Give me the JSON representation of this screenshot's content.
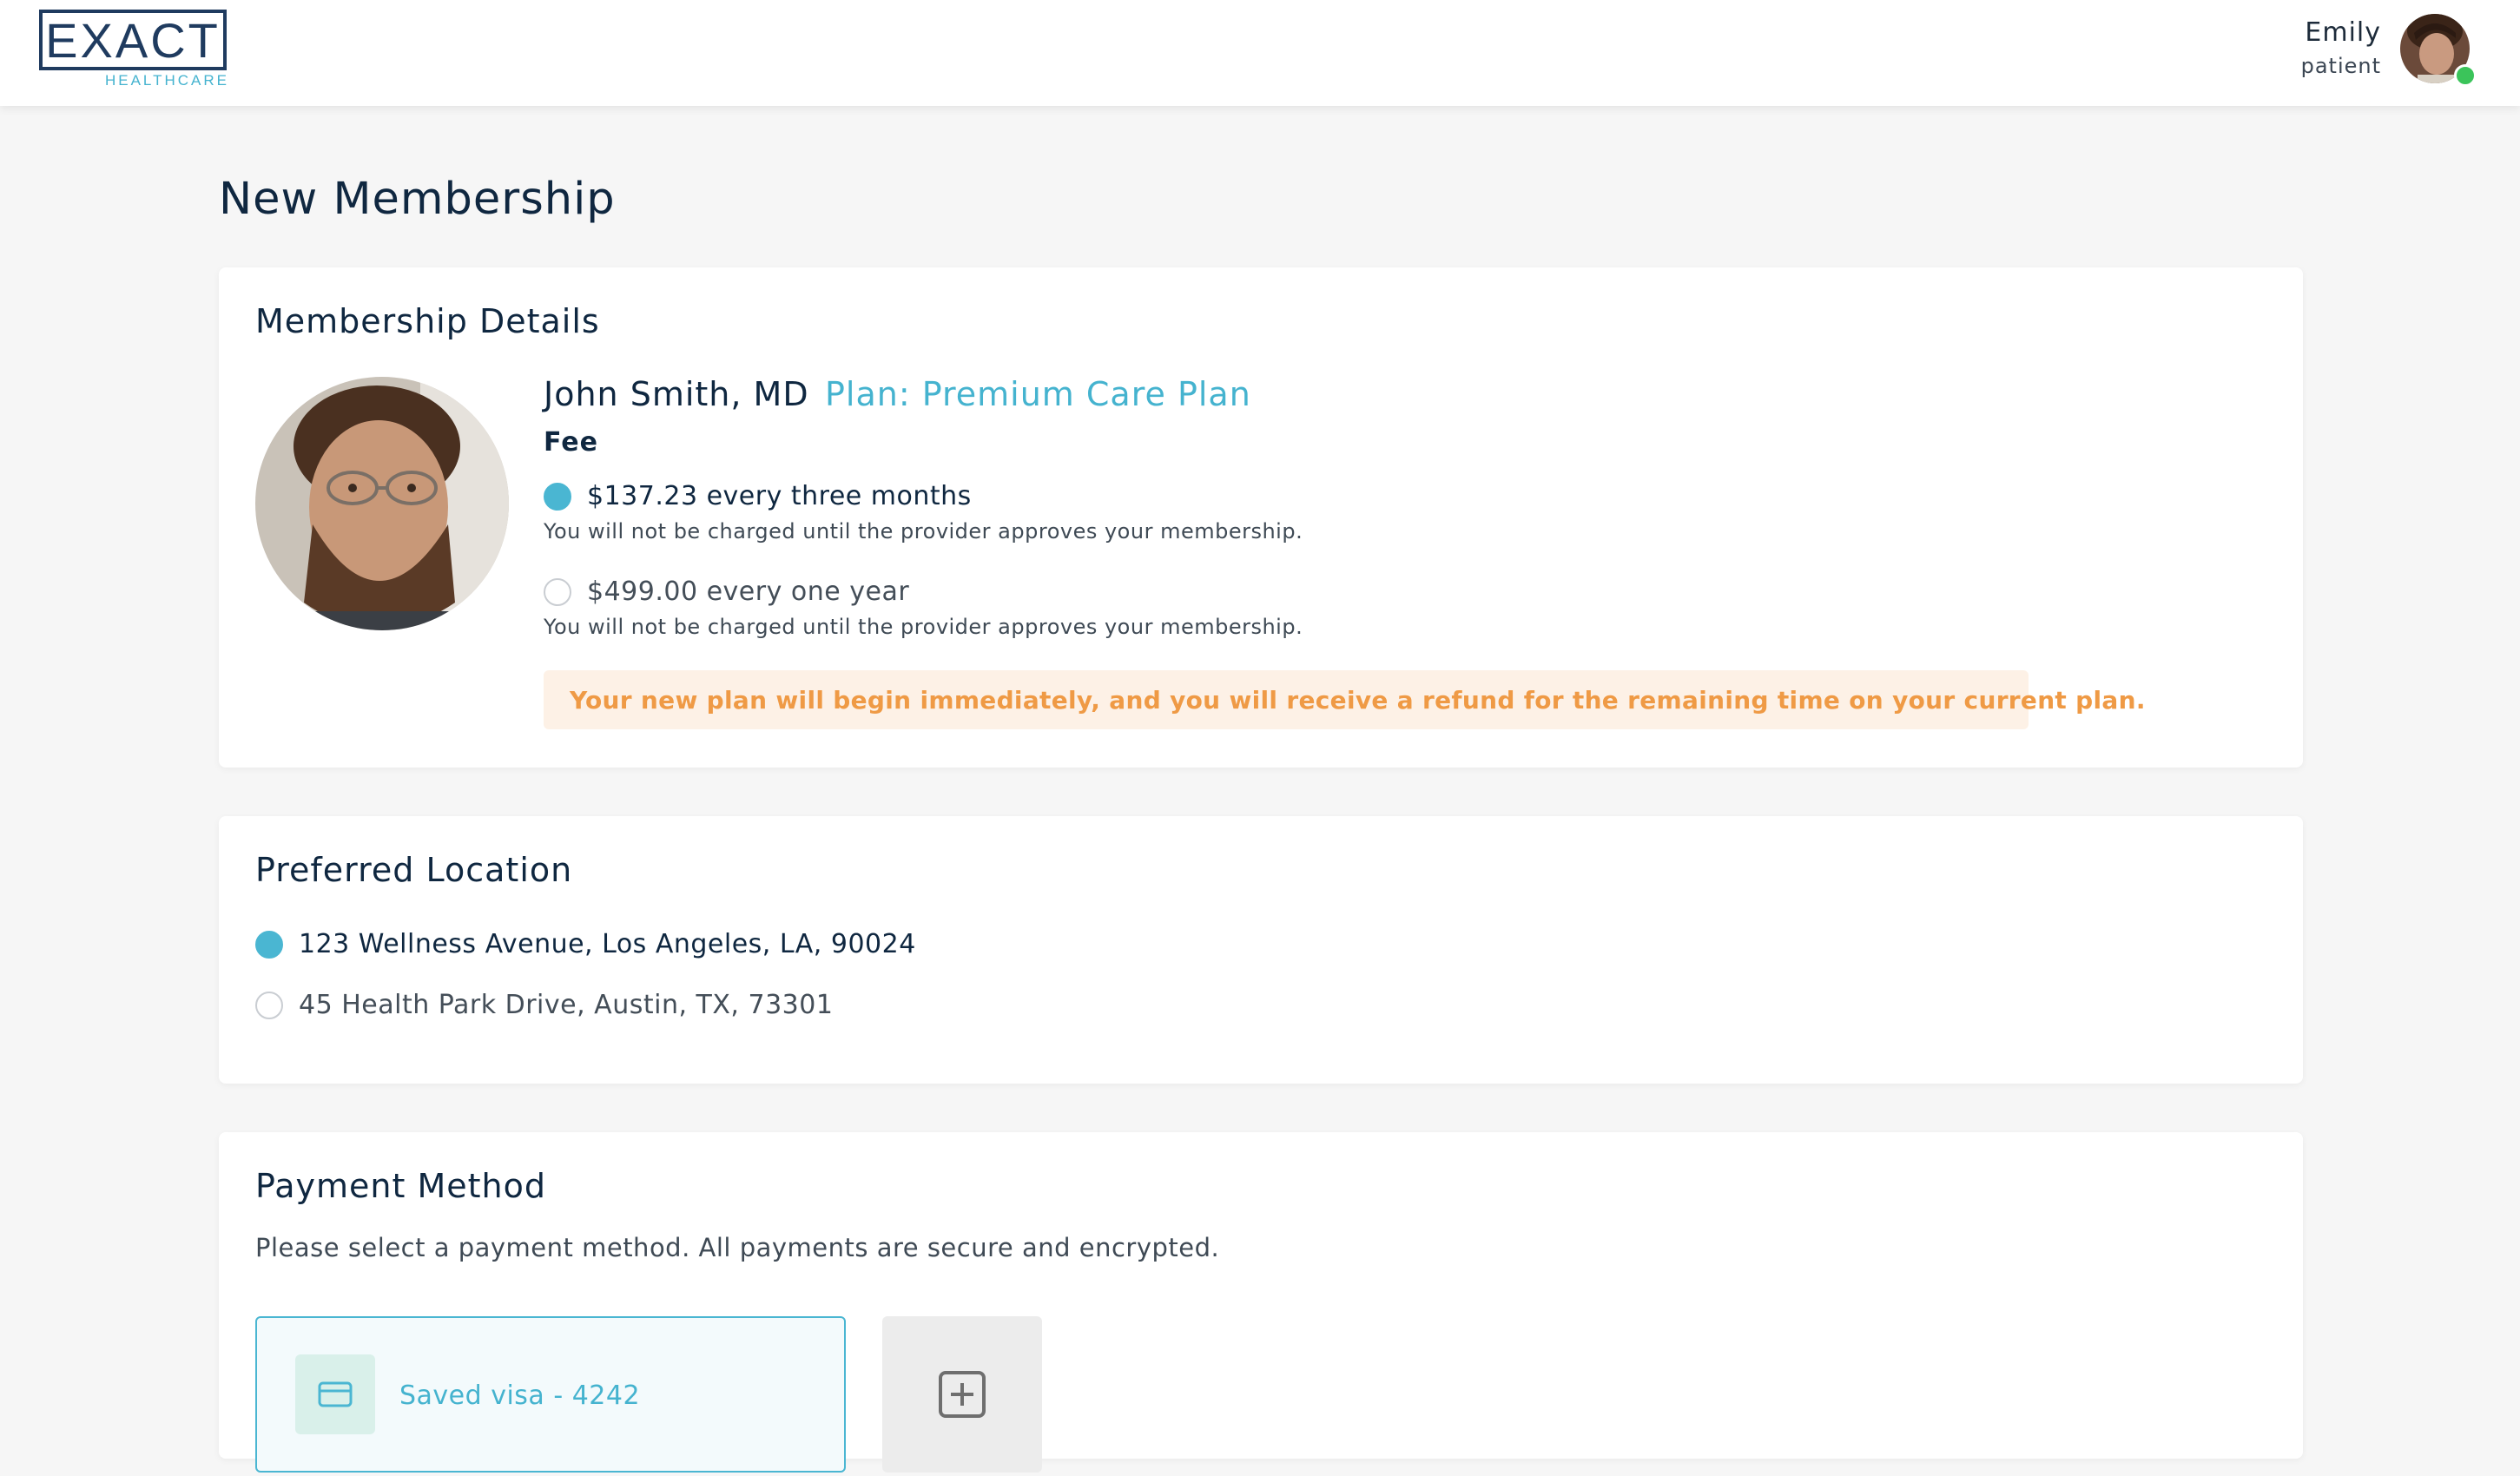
{
  "header": {
    "logo_main": "EXACT",
    "logo_sub": "HEALTHCARE",
    "user_name": "Emily",
    "user_role": "patient"
  },
  "page": {
    "title": "New Membership"
  },
  "membership": {
    "title": "Membership Details",
    "provider_name": "John Smith, MD",
    "plan": "Plan: Premium Care Plan",
    "fee_label": "Fee",
    "options": [
      {
        "label": "$137.23 every three months",
        "note": "You will not be charged until the provider approves your membership.",
        "selected": true
      },
      {
        "label": "$499.00 every one year",
        "note": "You will not be charged until the provider approves your membership.",
        "selected": false
      }
    ],
    "notice": "Your new plan will begin immediately, and you will receive a refund for the remaining time on your current plan."
  },
  "location": {
    "title": "Preferred Location",
    "options": [
      {
        "label": "123 Wellness Avenue, Los Angeles, LA, 90024",
        "selected": true
      },
      {
        "label": "45 Health Park Drive, Austin, TX, 73301",
        "selected": false
      }
    ]
  },
  "payment": {
    "title": "Payment Method",
    "description": "Please select a payment method. All payments are secure and encrypted.",
    "saved_card_label": "Saved visa - 4242"
  },
  "icons": {
    "card": "credit-card-icon",
    "add": "plus-square-icon"
  },
  "colors": {
    "accent": "#4ab6d2",
    "notice_text": "#ef9a45",
    "notice_bg": "#fdf1e6",
    "online": "#3bc45a"
  }
}
